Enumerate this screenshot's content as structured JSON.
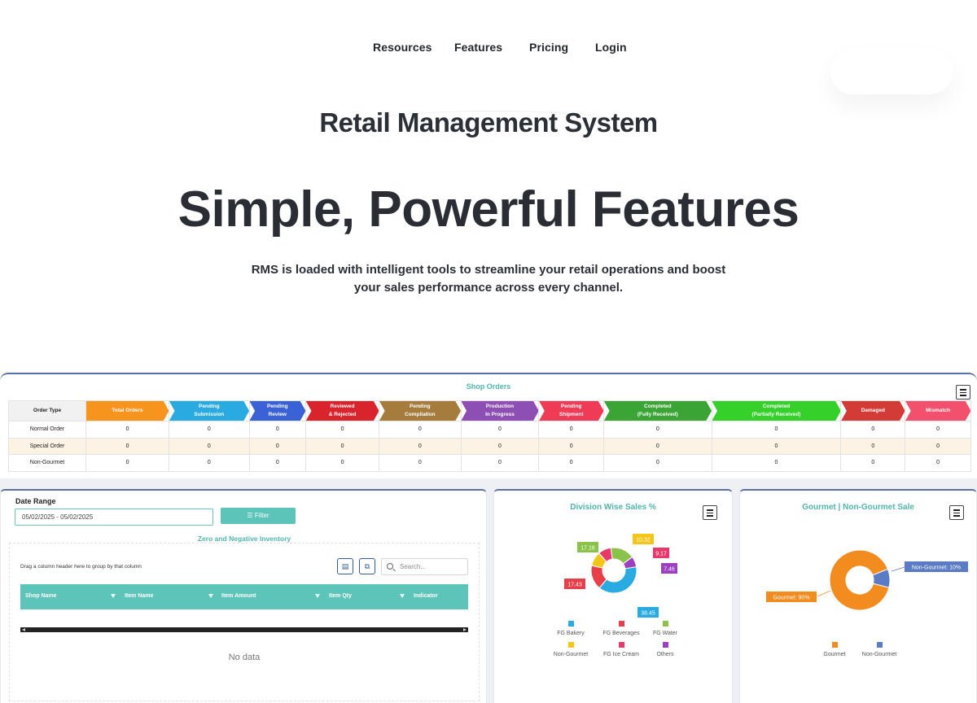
{
  "nav": {
    "items": [
      "Resources",
      "Features",
      "Pricing",
      "Login"
    ]
  },
  "hero": {
    "brand": "Retail Management System",
    "title": "Simple, Powerful Features",
    "subtitle_line1": "RMS is loaded with intelligent tools to streamline your retail operations and boost",
    "subtitle_line2": "your sales performance across every channel."
  },
  "shop_orders": {
    "title": "Shop Orders",
    "first_header": "Order Type",
    "columns": [
      {
        "l1": "Total Orders",
        "l2": "",
        "color": "#f7941d"
      },
      {
        "l1": "Pending",
        "l2": "Submission",
        "color": "#29abe2"
      },
      {
        "l1": "Pending",
        "l2": "Review",
        "color": "#3a62d6"
      },
      {
        "l1": "Reviewed",
        "l2": "& Rejected",
        "color": "#d9232d"
      },
      {
        "l1": "Pending",
        "l2": "Compilation",
        "color": "#a67c3d"
      },
      {
        "l1": "Production",
        "l2": "In Progress",
        "color": "#8e4fb5"
      },
      {
        "l1": "Pending",
        "l2": "Shipment",
        "color": "#ef3b55"
      },
      {
        "l1": "Completed",
        "l2": "(Fully Received)",
        "color": "#3aa535"
      },
      {
        "l1": "Completed",
        "l2": "(Partially Received)",
        "color": "#35d12a"
      },
      {
        "l1": "Damaged",
        "l2": "",
        "color": "#d33b36"
      },
      {
        "l1": "Mismatch",
        "l2": "",
        "color": "#f2506c"
      }
    ],
    "rows": [
      {
        "type": "Normal Order",
        "values": [
          "0",
          "0",
          "0",
          "0",
          "0",
          "0",
          "0",
          "0",
          "0",
          "0",
          "0"
        ]
      },
      {
        "type": "Special Order",
        "values": [
          "0",
          "0",
          "0",
          "0",
          "0",
          "0",
          "0",
          "0",
          "0",
          "0",
          "0"
        ]
      },
      {
        "type": "Non-Gourmet",
        "values": [
          "0",
          "0",
          "0",
          "0",
          "0",
          "0",
          "0",
          "0",
          "0",
          "0",
          "0"
        ]
      }
    ]
  },
  "inventory": {
    "date_range_label": "Date Range",
    "date_range_value": "05/02/2025 - 05/02/2025",
    "filter_label": "Filter",
    "title": "Zero and Negative Inventory",
    "drag_hint": "Drag a column header here to group by that column",
    "search_placeholder": "Search...",
    "columns": [
      "Shop Name",
      "Item Name",
      "Item Amount",
      "Item Qty",
      "Indicator"
    ],
    "empty_text": "No data"
  },
  "division_chart": {
    "title": "Division Wise Sales %",
    "legend": [
      {
        "name": "FG Bakery",
        "color": "#29abe2"
      },
      {
        "name": "FG Beverages",
        "color": "#e8404a"
      },
      {
        "name": "FG Water",
        "color": "#8bc34a"
      },
      {
        "name": "Non-Gourmet",
        "color": "#f5c518"
      },
      {
        "name": "FG Ice Cream",
        "color": "#e83a6a"
      },
      {
        "name": "Others",
        "color": "#9c3fc2"
      }
    ]
  },
  "gourmet_chart": {
    "title": "Gourmet | Non-Gourmet Sale",
    "legend": [
      {
        "name": "Gourmet",
        "color": "#f28c1e"
      },
      {
        "name": "Non-Gourmet",
        "color": "#5b7cc4"
      }
    ]
  },
  "chart_data": [
    {
      "type": "pie",
      "title": "Division Wise Sales %",
      "categories": [
        "FG Bakery",
        "FG Beverages",
        "FG Water",
        "Non-Gourmet",
        "FG Ice Cream",
        "Others"
      ],
      "values": [
        38.45,
        17.43,
        17.16,
        10.32,
        9.17,
        7.46
      ],
      "data_labels": [
        "38.45",
        "17.43",
        "17.16",
        "10.32",
        "9.17",
        "7.46"
      ],
      "legend_position": "bottom"
    },
    {
      "type": "pie",
      "title": "Gourmet | Non-Gourmet Sale",
      "categories": [
        "Gourmet",
        "Non-Gourmet"
      ],
      "values": [
        90,
        10
      ],
      "data_labels": [
        "Gourmet: 90%",
        "Non-Gourmet: 10%"
      ],
      "legend_position": "bottom"
    }
  ]
}
